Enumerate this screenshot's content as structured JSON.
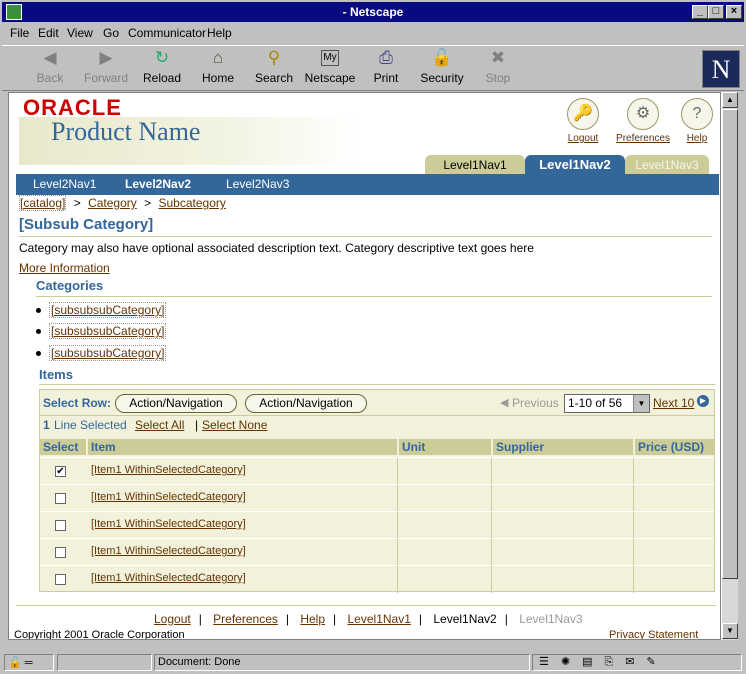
{
  "window": {
    "title": "- Netscape"
  },
  "menu": [
    "File",
    "Edit",
    "View",
    "Go",
    "Communicator",
    "Help"
  ],
  "toolbar": [
    {
      "label": "Back",
      "icon": "back-arrow-icon",
      "enabled": false
    },
    {
      "label": "Forward",
      "icon": "forward-arrow-icon",
      "enabled": false
    },
    {
      "label": "Reload",
      "icon": "reload-icon",
      "enabled": true
    },
    {
      "label": "Home",
      "icon": "home-icon",
      "enabled": true
    },
    {
      "label": "Search",
      "icon": "search-icon",
      "enabled": true
    },
    {
      "label": "Netscape",
      "icon": "my-netscape-icon",
      "enabled": true
    },
    {
      "label": "Print",
      "icon": "print-icon",
      "enabled": true
    },
    {
      "label": "Security",
      "icon": "lock-icon",
      "enabled": true
    },
    {
      "label": "Stop",
      "icon": "stop-icon",
      "enabled": false
    }
  ],
  "header": {
    "brand": "ORACLE",
    "product": "Product Name",
    "global_links": [
      "Logout",
      "Preferences",
      "Help"
    ],
    "tabs": [
      "Level1Nav1",
      "Level1Nav2",
      "Level1Nav3"
    ],
    "active_tab": "Level1Nav2",
    "subnav": [
      "Level2Nav1",
      "Level2Nav2",
      "Level2Nav3"
    ],
    "active_subnav": "Level2Nav2"
  },
  "breadcrumbs": [
    "[catalog]",
    ">",
    "Category",
    ">",
    "Subcategory"
  ],
  "page": {
    "title": "[Subsub Category]",
    "description": "Category may also have optional associated description text. Category descriptive text goes here",
    "more_info": "More Information"
  },
  "categories": {
    "heading": "Categories",
    "items": [
      "[subsubsubCategory]",
      "[subsubsubCategory]",
      "[subsubsubCategory]"
    ]
  },
  "items": {
    "heading": "Items",
    "select_row_label": "Select Row:",
    "actions": [
      "Action/Navigation",
      "Action/Navigation"
    ],
    "previous": "Previous",
    "range": "1-10 of 56",
    "next": "Next 10",
    "selected_count": "1",
    "selected_text": "Line Selected",
    "select_all": "Select All",
    "select_none": "Select None",
    "columns": [
      "Select",
      "Item",
      "Unit",
      "Supplier",
      "Price (USD)"
    ],
    "rows": [
      {
        "checked": true,
        "item": "[Item1 WithinSelectedCategory]",
        "unit": "",
        "supplier": "",
        "price": ""
      },
      {
        "checked": false,
        "item": "[Item1 WithinSelectedCategory]",
        "unit": "",
        "supplier": "",
        "price": ""
      },
      {
        "checked": false,
        "item": "[Item1 WithinSelectedCategory]",
        "unit": "",
        "supplier": "",
        "price": ""
      },
      {
        "checked": false,
        "item": "[Item1 WithinSelectedCategory]",
        "unit": "",
        "supplier": "",
        "price": ""
      },
      {
        "checked": false,
        "item": "[Item1 WithinSelectedCategory]",
        "unit": "",
        "supplier": "",
        "price": ""
      }
    ]
  },
  "footer": {
    "links": [
      "Logout",
      "Preferences",
      "Help",
      "Level1Nav1",
      "Level1Nav2",
      "Level1Nav3"
    ],
    "copyright": "Copyright 2001 Oracle Corporation",
    "privacy": "Privacy Statement"
  },
  "status": {
    "text": "Document: Done"
  },
  "colors": {
    "accent": "#336699",
    "tan": "#cccc99",
    "link": "#663300",
    "brand": "#cc0000"
  }
}
